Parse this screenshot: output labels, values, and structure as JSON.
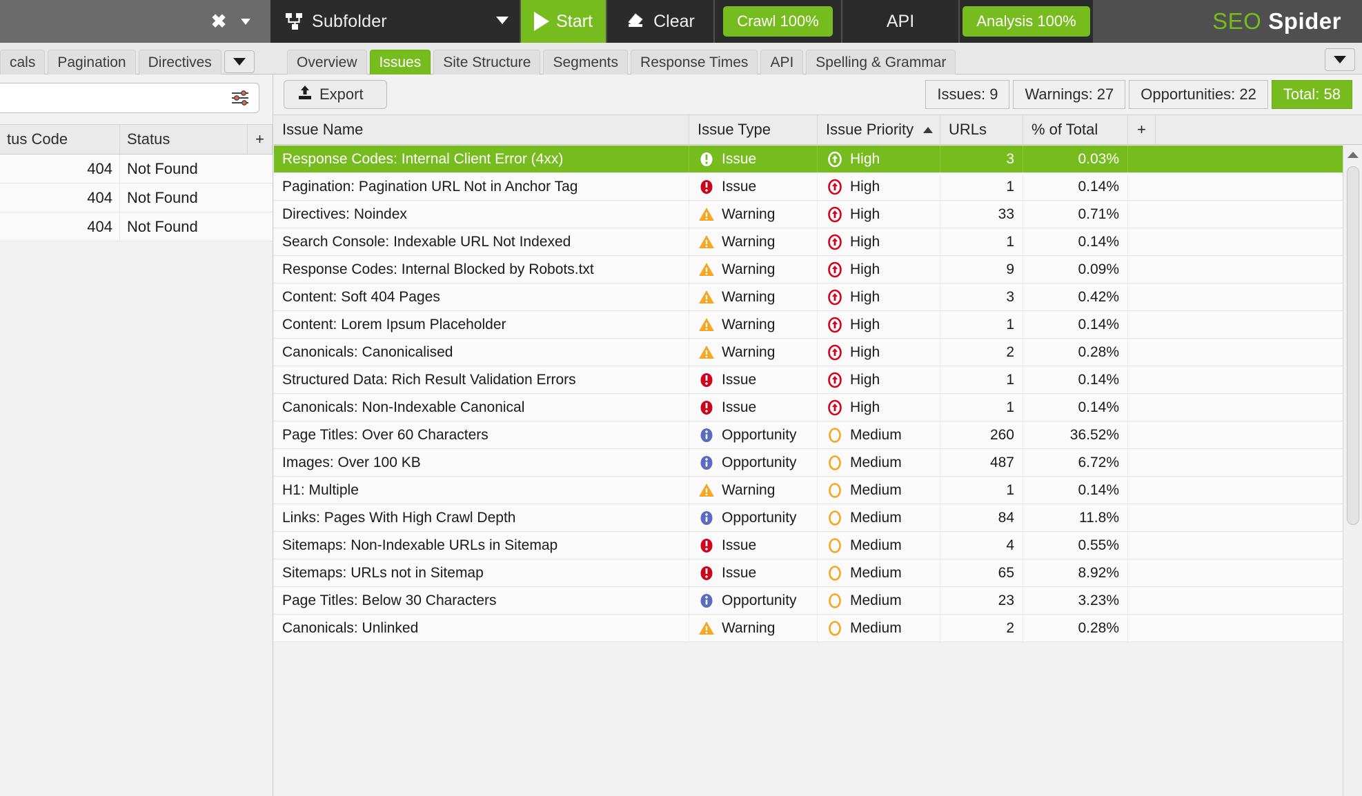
{
  "topbar": {
    "close_label": "✖",
    "mode_label": "Subfolder",
    "start_label": "Start",
    "clear_label": "Clear",
    "crawl_label": "Crawl 100%",
    "api_label": "API",
    "analysis_label": "Analysis 100%",
    "brand_seo": "SEO",
    "brand_spider": "Spider",
    "accent_green": "#77bc1f",
    "dark_bg": "#2b2b2b"
  },
  "left_tabs": {
    "items": [
      {
        "label": "cals",
        "active": false
      },
      {
        "label": "Pagination",
        "active": false
      },
      {
        "label": "Directives",
        "active": false
      }
    ]
  },
  "right_tabs": {
    "items": [
      {
        "label": "Overview",
        "active": false
      },
      {
        "label": "Issues",
        "active": true
      },
      {
        "label": "Site Structure",
        "active": false
      },
      {
        "label": "Segments",
        "active": false
      },
      {
        "label": "Response Times",
        "active": false
      },
      {
        "label": "API",
        "active": false
      },
      {
        "label": "Spelling & Grammar",
        "active": false
      }
    ]
  },
  "left_panel": {
    "search_placeholder": "",
    "search_value": "",
    "columns": [
      "tus Code",
      "Status",
      "+"
    ],
    "rows": [
      {
        "code": "404",
        "status": "Not Found"
      },
      {
        "code": "404",
        "status": "Not Found"
      },
      {
        "code": "404",
        "status": "Not Found"
      }
    ]
  },
  "toolbar": {
    "export_label": "Export",
    "counters": [
      {
        "label": "Issues: 9",
        "highlight": false
      },
      {
        "label": "Warnings: 27",
        "highlight": false
      },
      {
        "label": "Opportunities: 22",
        "highlight": false
      },
      {
        "label": "Total: 58",
        "highlight": true
      }
    ]
  },
  "table": {
    "columns": [
      "Issue Name",
      "Issue Type",
      "Issue Priority",
      "URLs",
      "% of Total",
      "+"
    ],
    "sorted_column": "Issue Priority",
    "sort_direction": "asc",
    "rows": [
      {
        "name": "Response Codes: Internal Client Error (4xx)",
        "type": "Issue",
        "type_icon": "issue-icon",
        "priority": "High",
        "priority_icon": "high-icon",
        "urls": "3",
        "pct": "0.03%",
        "selected": true
      },
      {
        "name": "Pagination: Pagination URL Not in Anchor Tag",
        "type": "Issue",
        "type_icon": "issue-icon",
        "priority": "High",
        "priority_icon": "high-icon",
        "urls": "1",
        "pct": "0.14%",
        "selected": false
      },
      {
        "name": "Directives: Noindex",
        "type": "Warning",
        "type_icon": "warning-icon",
        "priority": "High",
        "priority_icon": "high-icon",
        "urls": "33",
        "pct": "0.71%",
        "selected": false
      },
      {
        "name": "Search Console: Indexable URL Not Indexed",
        "type": "Warning",
        "type_icon": "warning-icon",
        "priority": "High",
        "priority_icon": "high-icon",
        "urls": "1",
        "pct": "0.14%",
        "selected": false
      },
      {
        "name": "Response Codes: Internal Blocked by Robots.txt",
        "type": "Warning",
        "type_icon": "warning-icon",
        "priority": "High",
        "priority_icon": "high-icon",
        "urls": "9",
        "pct": "0.09%",
        "selected": false
      },
      {
        "name": "Content: Soft 404 Pages",
        "type": "Warning",
        "type_icon": "warning-icon",
        "priority": "High",
        "priority_icon": "high-icon",
        "urls": "3",
        "pct": "0.42%",
        "selected": false
      },
      {
        "name": "Content: Lorem Ipsum Placeholder",
        "type": "Warning",
        "type_icon": "warning-icon",
        "priority": "High",
        "priority_icon": "high-icon",
        "urls": "1",
        "pct": "0.14%",
        "selected": false
      },
      {
        "name": "Canonicals: Canonicalised",
        "type": "Warning",
        "type_icon": "warning-icon",
        "priority": "High",
        "priority_icon": "high-icon",
        "urls": "2",
        "pct": "0.28%",
        "selected": false
      },
      {
        "name": "Structured Data: Rich Result Validation Errors",
        "type": "Issue",
        "type_icon": "issue-icon",
        "priority": "High",
        "priority_icon": "high-icon",
        "urls": "1",
        "pct": "0.14%",
        "selected": false
      },
      {
        "name": "Canonicals: Non-Indexable Canonical",
        "type": "Issue",
        "type_icon": "issue-icon",
        "priority": "High",
        "priority_icon": "high-icon",
        "urls": "1",
        "pct": "0.14%",
        "selected": false
      },
      {
        "name": "Page Titles: Over 60 Characters",
        "type": "Opportunity",
        "type_icon": "opportunity-icon",
        "priority": "Medium",
        "priority_icon": "medium-icon",
        "urls": "260",
        "pct": "36.52%",
        "selected": false
      },
      {
        "name": "Images: Over 100 KB",
        "type": "Opportunity",
        "type_icon": "opportunity-icon",
        "priority": "Medium",
        "priority_icon": "medium-icon",
        "urls": "487",
        "pct": "6.72%",
        "selected": false
      },
      {
        "name": "H1: Multiple",
        "type": "Warning",
        "type_icon": "warning-icon",
        "priority": "Medium",
        "priority_icon": "medium-icon",
        "urls": "1",
        "pct": "0.14%",
        "selected": false
      },
      {
        "name": "Links: Pages With High Crawl Depth",
        "type": "Opportunity",
        "type_icon": "opportunity-icon",
        "priority": "Medium",
        "priority_icon": "medium-icon",
        "urls": "84",
        "pct": "11.8%",
        "selected": false
      },
      {
        "name": "Sitemaps: Non-Indexable URLs in Sitemap",
        "type": "Issue",
        "type_icon": "issue-icon",
        "priority": "Medium",
        "priority_icon": "medium-icon",
        "urls": "4",
        "pct": "0.55%",
        "selected": false
      },
      {
        "name": "Sitemaps: URLs not in Sitemap",
        "type": "Issue",
        "type_icon": "issue-icon",
        "priority": "Medium",
        "priority_icon": "medium-icon",
        "urls": "65",
        "pct": "8.92%",
        "selected": false
      },
      {
        "name": "Page Titles: Below 30 Characters",
        "type": "Opportunity",
        "type_icon": "opportunity-icon",
        "priority": "Medium",
        "priority_icon": "medium-icon",
        "urls": "23",
        "pct": "3.23%",
        "selected": false
      },
      {
        "name": "Canonicals: Unlinked",
        "type": "Warning",
        "type_icon": "warning-icon",
        "priority": "Medium",
        "priority_icon": "medium-icon",
        "urls": "2",
        "pct": "0.28%",
        "selected": false
      }
    ]
  },
  "colors": {
    "issue_red": "#d0021b",
    "warning_amber": "#f5a623",
    "opportunity_blue": "#5b6bbf",
    "selected_green": "#77bc1f"
  }
}
